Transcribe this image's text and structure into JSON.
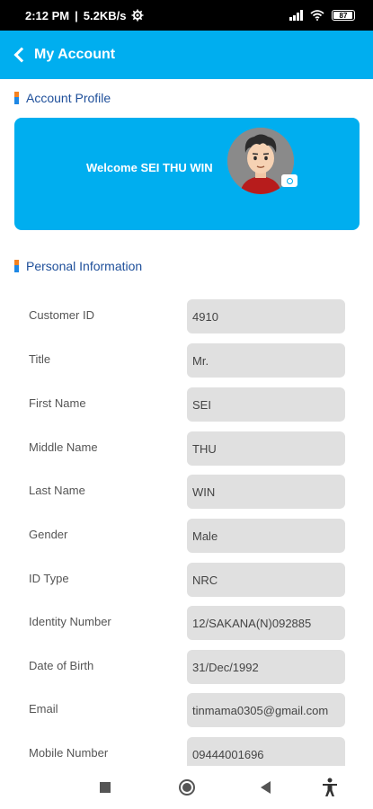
{
  "status_bar": {
    "time": "2:12 PM",
    "net_speed": "5.2KB/s",
    "battery": "87"
  },
  "app_bar": {
    "title": "My Account"
  },
  "profile": {
    "section_title": "Account Profile",
    "welcome": "Welcome SEI THU WIN"
  },
  "personal": {
    "section_title": "Personal Information",
    "fields": [
      {
        "label": "Customer ID",
        "value": "4910"
      },
      {
        "label": "Title",
        "value": "Mr."
      },
      {
        "label": "First Name",
        "value": "SEI"
      },
      {
        "label": "Middle Name",
        "value": "THU"
      },
      {
        "label": "Last Name",
        "value": "WIN"
      },
      {
        "label": "Gender",
        "value": "Male"
      },
      {
        "label": "ID Type",
        "value": "NRC"
      },
      {
        "label": "Identity Number",
        "value": "12/SAKANA(N)092885"
      },
      {
        "label": "Date of Birth",
        "value": "31/Dec/1992"
      },
      {
        "label": "Email",
        "value": "tinmama0305@gmail.com"
      },
      {
        "label": "Mobile Number",
        "value": "09444001696"
      }
    ]
  },
  "colors": {
    "primary": "#00aeef",
    "section_text": "#1e4f9a",
    "accent_orange": "#f58220",
    "field_bg": "#e0e0e0"
  },
  "icons": {
    "back": "chevron-left-icon",
    "camera": "camera-icon",
    "nav_recents": "square-icon",
    "nav_home": "circle-icon",
    "nav_back": "triangle-back-icon",
    "accessibility": "accessibility-icon"
  }
}
